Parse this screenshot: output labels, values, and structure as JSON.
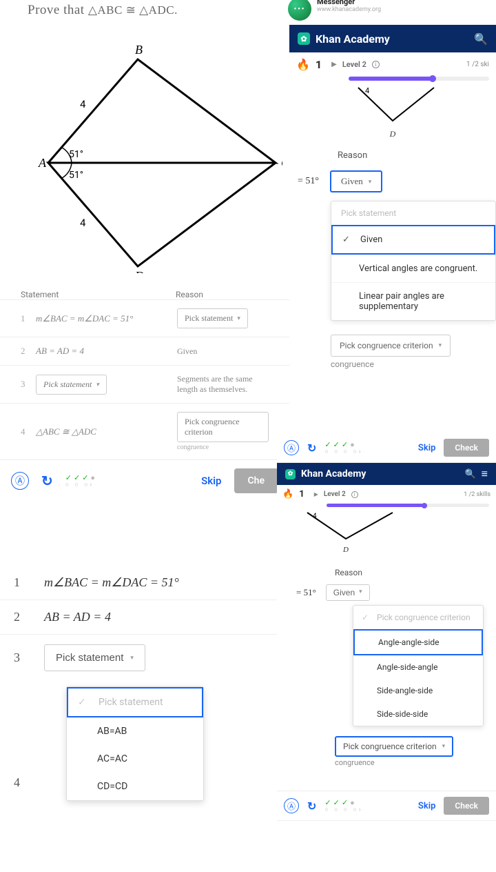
{
  "messenger": {
    "title": "Messenger",
    "url": "www.khanacademy.org"
  },
  "ka": {
    "brand": "Khan Academy",
    "search_icon": "search",
    "menu_icon": "menu"
  },
  "level_bar": {
    "streak": "1",
    "level": "Level 2",
    "fraction": "1 /2 ski",
    "fraction2": "1 /2 skills"
  },
  "problem": {
    "title_prefix": "Prove that ",
    "title_math": "△ABC ≅ △ADC.",
    "labels": {
      "A": "A",
      "B": "B",
      "C": "C",
      "D": "D",
      "ab": "4",
      "ad": "4",
      "ang1": "51°",
      "ang2": "51°"
    }
  },
  "proof_small": {
    "head_stmt": "Statement",
    "head_rsn": "Reason",
    "rows": [
      {
        "n": "1",
        "stmt": "m∠BAC = m∠DAC = 51°",
        "rsn_btn": "Pick statement"
      },
      {
        "n": "2",
        "stmt": "AB = AD = 4",
        "rsn_text": "Given"
      },
      {
        "n": "3",
        "stmt_btn": "Pick statement",
        "rsn_text": "Segments are the same length as themselves."
      },
      {
        "n": "4",
        "stmt": "△ABC ≅ △ADC",
        "rsn_btn": "Pick congruence criterion",
        "rsn_sub": "congruence"
      }
    ]
  },
  "actions": {
    "skip": "Skip",
    "check": "Check",
    "check_cut": "Che"
  },
  "panel2": {
    "D_label": "D",
    "four": "4",
    "reason": "Reason",
    "eq": "= 51°",
    "given": "Given",
    "dd_header": "Pick statement",
    "opts": [
      "Given",
      "Vertical angles are congruent.",
      "Linear pair angles are supplementary"
    ],
    "pcc": "Pick congruence criterion",
    "congr": "congruence"
  },
  "panel3": {
    "rows": [
      {
        "n": "1",
        "stmt": "m∠BAC = m∠DAC = 51°"
      },
      {
        "n": "2",
        "stmt": "AB = AD = 4"
      },
      {
        "n": "3",
        "btn": "Pick statement"
      },
      {
        "n": "4",
        "stmt": ""
      }
    ],
    "dd_header": "Pick statement",
    "opts": [
      "AB=AB",
      "AC=AC",
      "CD=CD"
    ]
  },
  "panel4": {
    "reason": "Reason",
    "eq": "= 51°",
    "given": "Given",
    "dd_header": "Pick congruence criterion",
    "opts": [
      "Angle-angle-side",
      "Angle-side-angle",
      "Side-angle-side",
      "Side-side-side"
    ],
    "pcc": "Pick congruence criterion",
    "congr": "congruence",
    "D_label": "D",
    "four": "4"
  }
}
